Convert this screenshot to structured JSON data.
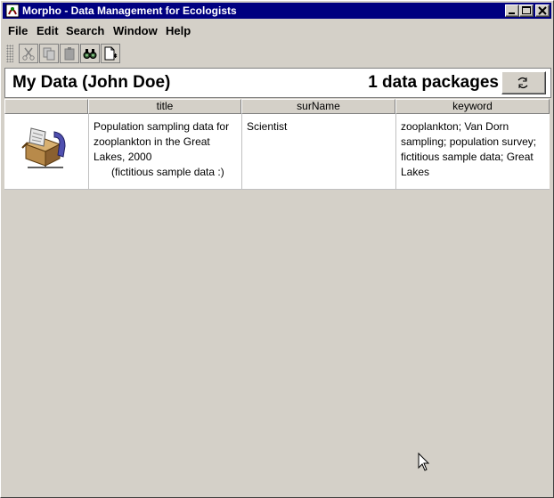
{
  "window": {
    "title": "Morpho - Data Management for Ecologists",
    "buttons": {
      "minimize": "minimize",
      "maximize": "maximize",
      "close": "close"
    }
  },
  "menubar": {
    "items": [
      {
        "label": "File"
      },
      {
        "label": "Edit"
      },
      {
        "label": "Search"
      },
      {
        "label": "Window"
      },
      {
        "label": "Help"
      }
    ]
  },
  "toolbar": {
    "buttons": [
      "cut-icon",
      "copy-icon",
      "paste-icon",
      "search-binoculars-icon",
      "new-document-icon"
    ]
  },
  "header": {
    "title": "My Data (John Doe)",
    "count": "1 data packages",
    "refresh_icon": "refresh-icon"
  },
  "table": {
    "columns": [
      "",
      "title",
      "surName",
      "keyword"
    ],
    "rows": [
      {
        "icon": "data-package-icon",
        "title": "Population sampling data for zooplankton in the Great Lakes, 2000\n      (fictitious sample data :)",
        "surName": "Scientist",
        "keyword": "zooplankton; Van Dorn sampling; population survey; fictitious sample data; Great Lakes"
      }
    ]
  },
  "colors": {
    "titlebar": "#000080",
    "window_bg": "#d4d0c8",
    "panel_bg": "#ffffff"
  }
}
